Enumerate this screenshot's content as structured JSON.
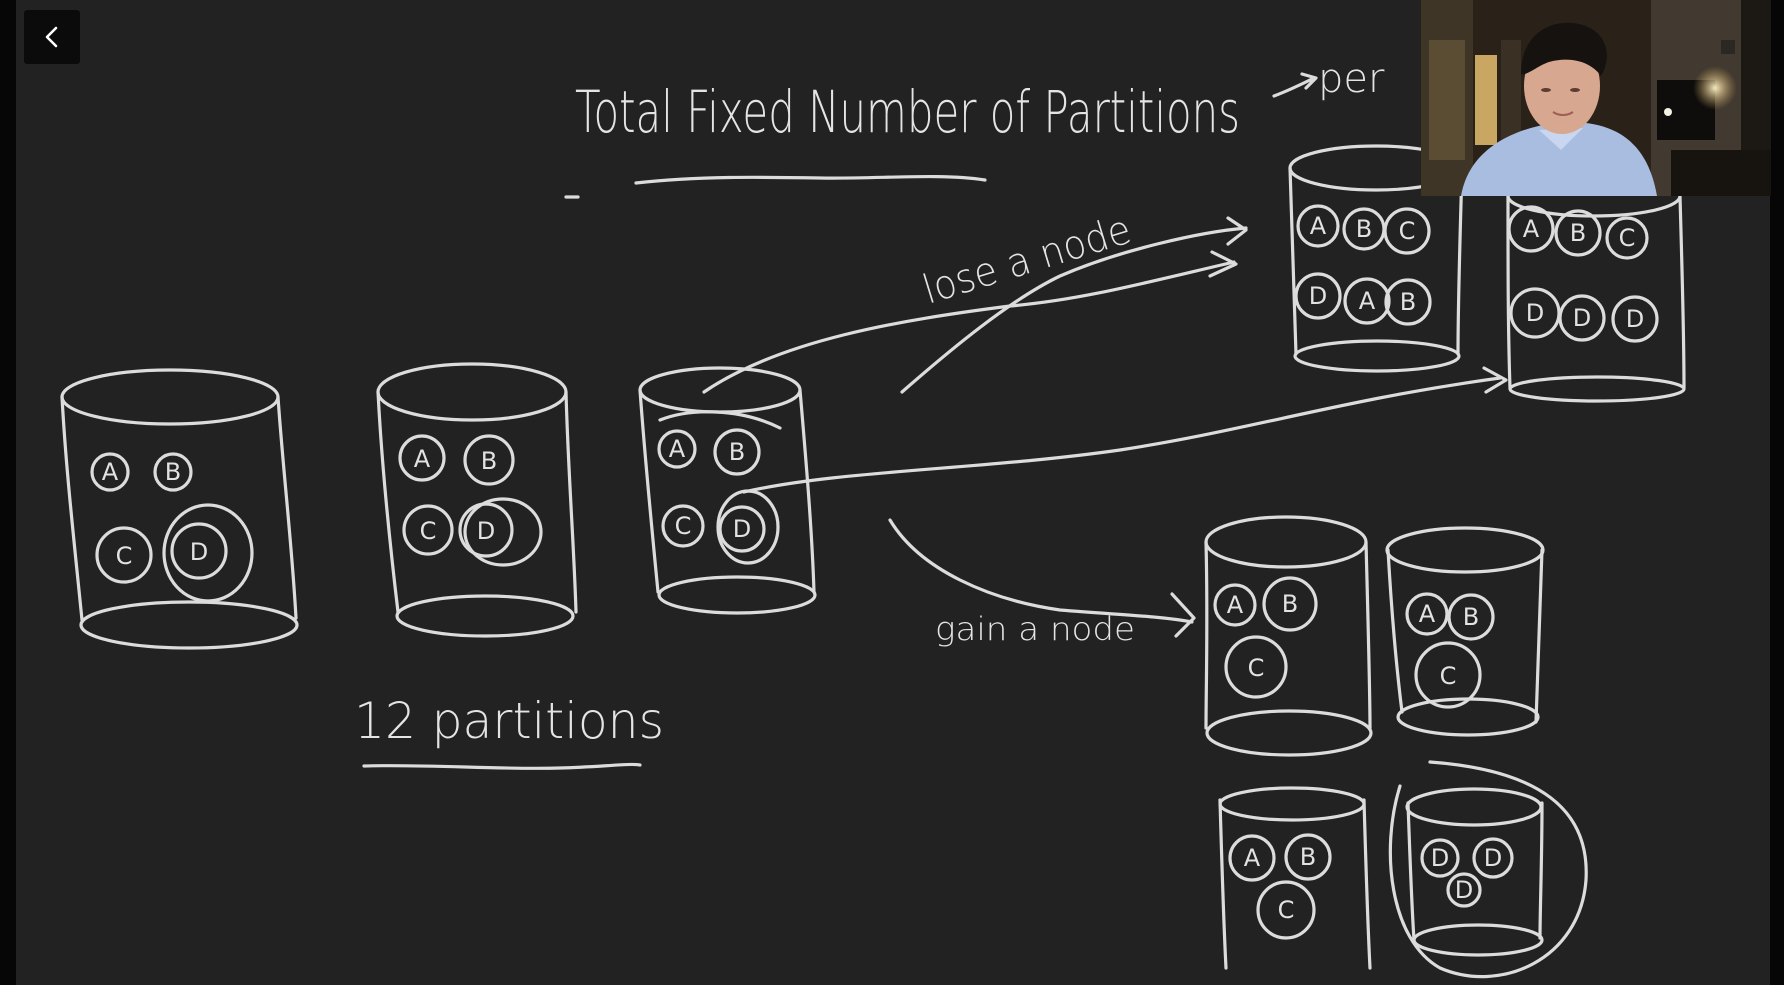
{
  "player": {
    "back_icon": "chevron-left-icon"
  },
  "whiteboard": {
    "title": "Total Fixed Number of Partitions",
    "title_note": "per",
    "caption": "12 partitions",
    "arrow_top_label": "lose a node",
    "arrow_bottom_label": "gain a node",
    "partition_letters": [
      "A",
      "B",
      "C",
      "D"
    ]
  },
  "webcam": {
    "description": "presenter-camera-feed"
  },
  "colors": {
    "background": "#222222",
    "ink": "#e0e0e0",
    "frame": "#060606"
  }
}
